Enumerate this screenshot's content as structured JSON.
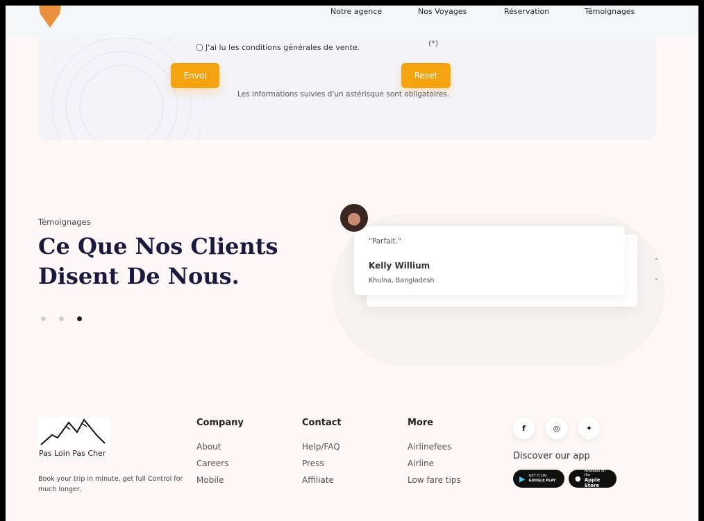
{
  "nav": {
    "links": [
      "Notre agence",
      "Nos Voyages",
      "Réservation",
      "Témoignages"
    ]
  },
  "form": {
    "terms_label": "J'ai lu les conditions générales de vente.",
    "required_mark": "(*)",
    "send_label": "Envoi",
    "reset_label": "Reset",
    "required_note": "Les informations suivies d'un astérisque sont obligatoires."
  },
  "testimonials": {
    "eyebrow": "Témoignages",
    "heading": "Ce Que Nos Clients Disent De Nous.",
    "quote": "\"Parfait.\"",
    "author": "Kelly Willium",
    "location": "Khulna, Bangladesh",
    "arrow_up": "˄",
    "arrow_down": "˅",
    "active_dot": 3
  },
  "footer": {
    "brand": "Pas Loin Pas Cher",
    "description": "Book your trip in minute, get full Control for much longer.",
    "columns": [
      {
        "title": "Company",
        "links": [
          "About",
          "Careers",
          "Mobile"
        ]
      },
      {
        "title": "Contact",
        "links": [
          "Help/FAQ",
          "Press",
          "Affiliate"
        ]
      },
      {
        "title": "More",
        "links": [
          "Airlinefees",
          "Airline",
          "Low fare tips"
        ]
      }
    ],
    "socials": {
      "facebook": "f",
      "instagram": "◎",
      "twitter": "✦"
    },
    "discover": "Discover our app",
    "google_play": {
      "small": "GET IT ON",
      "big": "GOOGLE PLAY"
    },
    "app_store": {
      "small": "Available on the",
      "big": "Apple Store"
    }
  },
  "colors": {
    "accent": "#f5a30f",
    "heading": "#1b1a3e",
    "nav_bg": "#f3f7f8"
  }
}
